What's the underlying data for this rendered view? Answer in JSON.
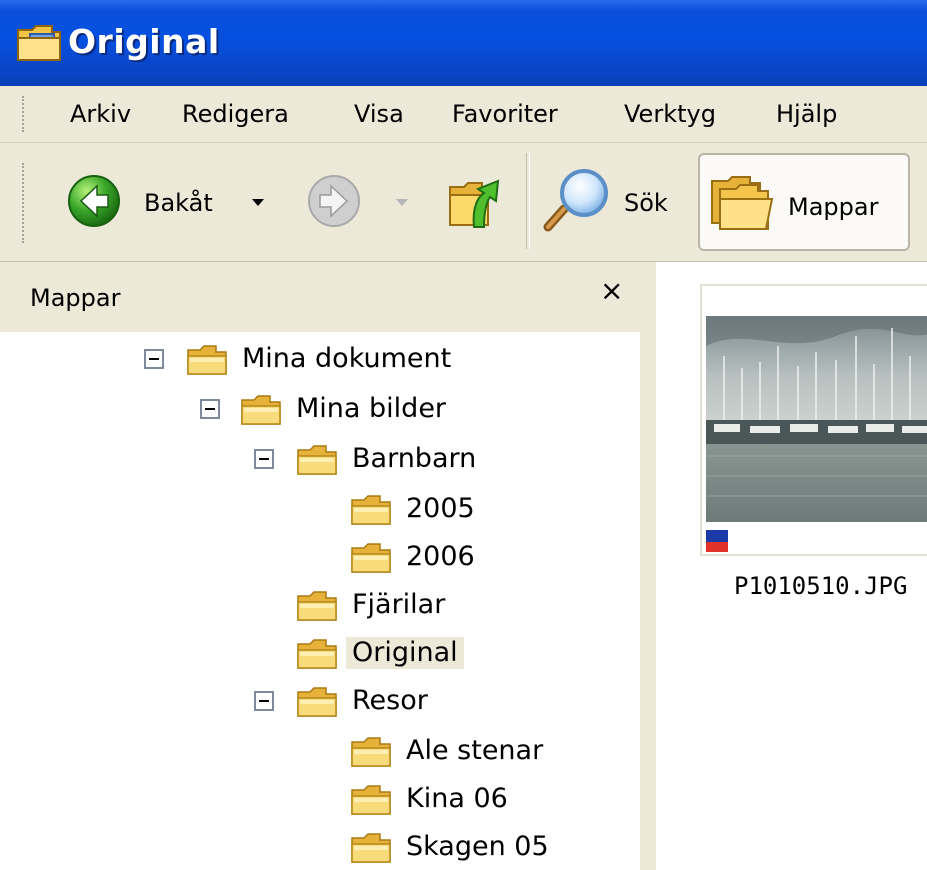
{
  "window": {
    "title": "Original",
    "title_bar_color": "#0a4fdc"
  },
  "menu": {
    "items": [
      "Arkiv",
      "Redigera",
      "Visa",
      "Favoriter",
      "Verktyg",
      "Hjälp"
    ]
  },
  "toolbar": {
    "back_label": "Bakåt",
    "search_label": "Sök",
    "folders_label": "Mappar",
    "icons": [
      "back-arrow-icon",
      "dropdown-arrow-icon",
      "forward-arrow-icon",
      "folder-up-icon",
      "search-magnifier-icon",
      "folders-icon"
    ]
  },
  "folder_pane": {
    "title": "Mappar",
    "close_glyph": "×",
    "tree": [
      {
        "label": "Mina dokument",
        "expanded": true
      },
      {
        "label": "Mina bilder",
        "expanded": true
      },
      {
        "label": "Barnbarn",
        "expanded": true
      },
      {
        "label": "2005"
      },
      {
        "label": "2006"
      },
      {
        "label": "Fjärilar"
      },
      {
        "label": "Original",
        "selected": true
      },
      {
        "label": "Resor",
        "expanded": true
      },
      {
        "label": "Ale stenar"
      },
      {
        "label": "Kina 06"
      },
      {
        "label": "Skagen 05"
      }
    ]
  },
  "content": {
    "thumbnails": [
      {
        "filename": "P1010510.JPG"
      }
    ]
  }
}
